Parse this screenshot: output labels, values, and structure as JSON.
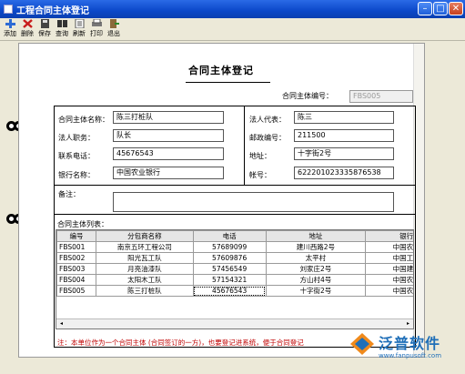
{
  "window": {
    "title": "工程合同主体登记"
  },
  "toolbar": {
    "buttons": [
      {
        "label": "添加",
        "icon": "add-icon",
        "color": "#2e6bd4"
      },
      {
        "label": "删除",
        "icon": "delete-icon",
        "color": "#c81d1d"
      },
      {
        "label": "保存",
        "icon": "save-icon",
        "color": "#333333"
      },
      {
        "label": "查询",
        "icon": "search-icon",
        "color": "#333333"
      },
      {
        "label": "刷新",
        "icon": "refresh-icon",
        "color": "#333333"
      },
      {
        "label": "打印",
        "icon": "print-icon",
        "color": "#555555"
      },
      {
        "label": "退出",
        "icon": "exit-icon",
        "color": "#555555"
      }
    ]
  },
  "form": {
    "title": "合同主体登记",
    "contract_no_label": "合同主体编号：",
    "contract_no_value": "FBS005",
    "fields": {
      "name_label": "合同主体名称：",
      "name_value": "陈三打桩队",
      "legal_label": "法人代表：",
      "legal_value": "陈三",
      "duty_label": "法人职务：",
      "duty_value": "队长",
      "postcode_label": "邮政编号：",
      "postcode_value": "211500",
      "phone_label": "联系电话：",
      "phone_value": "45676543",
      "address_label": "地址：",
      "address_value": "十字街2号",
      "bank_label": "银行名称：",
      "bank_value": "中国农业银行",
      "account_label": "帐号：",
      "account_value": "622201023335876538",
      "remark_label": "备注：",
      "remark_value": ""
    },
    "list_label": "合同主体列表："
  },
  "table": {
    "headers": [
      "编号",
      "分包商名称",
      "电话",
      "地址",
      "银行"
    ],
    "rows": [
      [
        "FBS001",
        "南京五环工程公司",
        "57689099",
        "建川西路2号",
        "中国农业"
      ],
      [
        "FBS002",
        "阳光瓦工队",
        "57609876",
        "太平村",
        "中国工商"
      ],
      [
        "FBS003",
        "月亮油漆队",
        "57456549",
        "刘家庄2号",
        "中国建设"
      ],
      [
        "FBS004",
        "太阳木工队",
        "57154321",
        "方山村4号",
        "中国农业"
      ],
      [
        "FBS005",
        "陈三打桩队",
        "45676543",
        "十字街2号",
        "中国农业"
      ]
    ]
  },
  "note": "注：本单位作为一个合同主体 (合同签订的一方)，也要登记进系统，便于合同登记",
  "brand": {
    "name": "泛普软件",
    "url": "www.fanpusoft.com",
    "color": "#1f6fb8",
    "accent": "#f08a1c"
  }
}
